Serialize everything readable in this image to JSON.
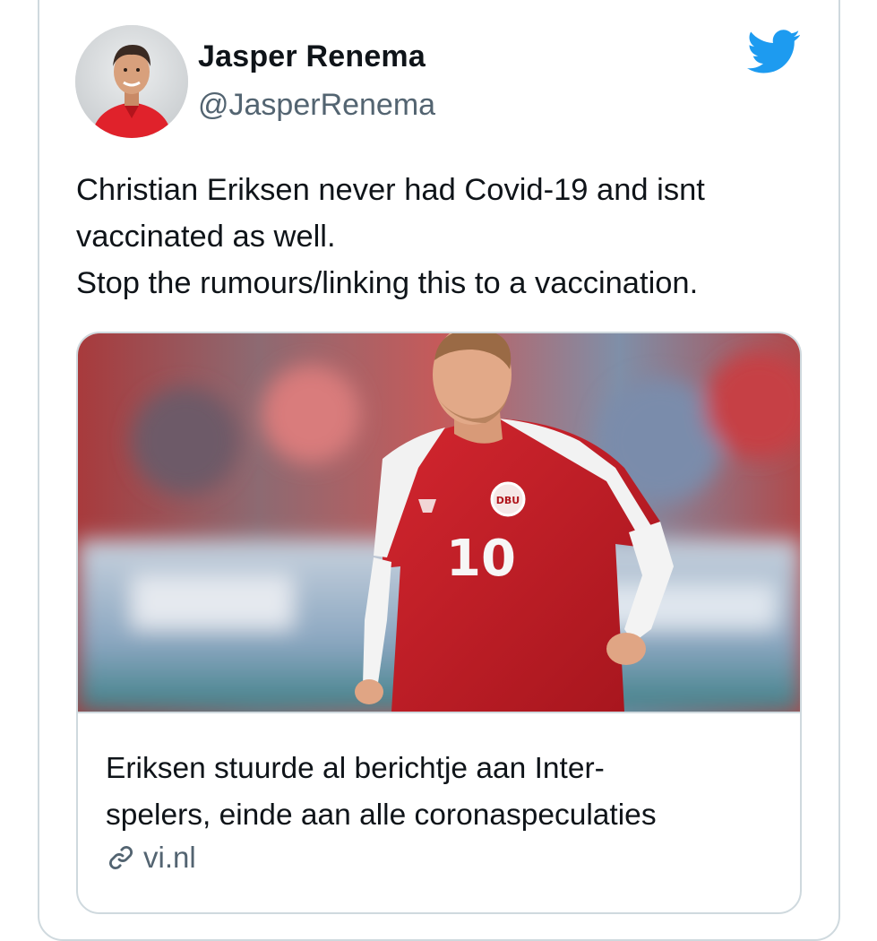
{
  "author": {
    "name": "Jasper Renema",
    "handle": "@JasperRenema",
    "avatar_icon": "user-avatar-photo"
  },
  "brand": {
    "icon": "twitter-bird-icon",
    "color": "#1d9bf0"
  },
  "tweet": {
    "lines": [
      "Christian Eriksen never had Covid-19 and isnt",
      "vaccinated as well.",
      "Stop the rumours/linking this to a vaccination."
    ]
  },
  "link_card": {
    "title_lines": [
      "Eriksen stuurde al berichtje aan Inter-",
      "spelers, einde aan alle coronaspeculaties"
    ],
    "domain": "vi.nl",
    "domain_icon": "link-icon",
    "image": {
      "subject": "football-player-photo",
      "shirt_number": "10",
      "shirt_badge": "DBU"
    }
  },
  "colors": {
    "text": "#0f1419",
    "secondary": "#536471",
    "border": "#cfd9de"
  }
}
